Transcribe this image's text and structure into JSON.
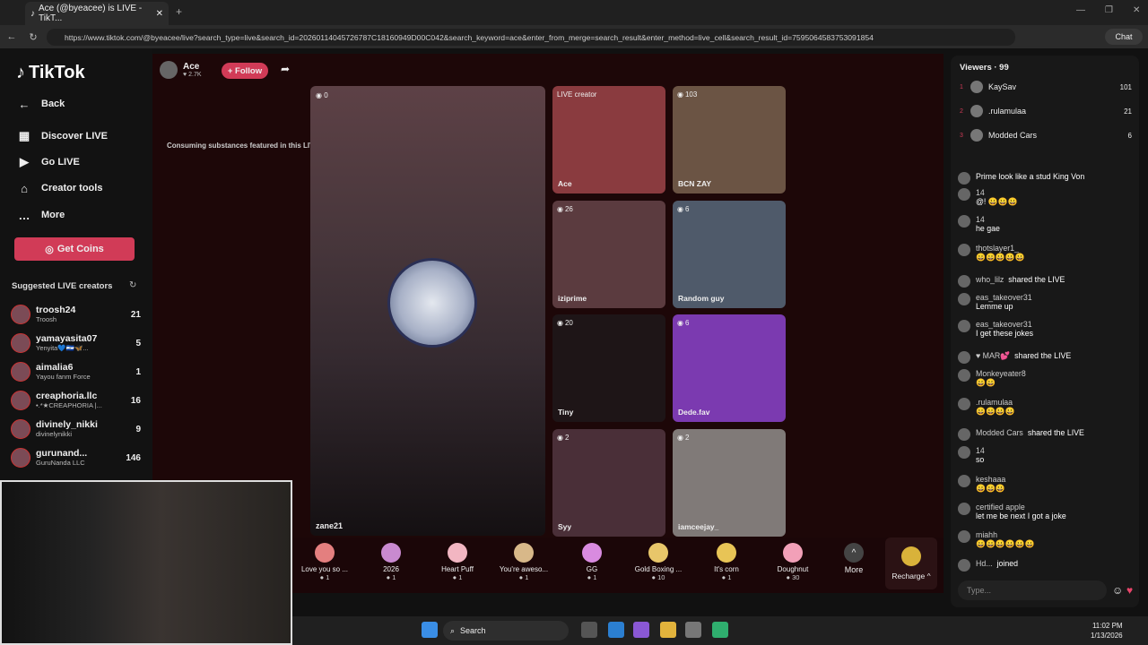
{
  "browser": {
    "tab_title": "Ace (@byeacee) is LIVE - TikT...",
    "url": "https://www.tiktok.com/@byeacee/live?search_type=live&search_id=20260114045726787C18160949D00C042&search_keyword=ace&enter_from_merge=search_result&enter_method=live_cell&search_result_id=7595064583753091854",
    "chat_label": "Chat"
  },
  "sidebar": {
    "logo": "TikTok",
    "nav": [
      {
        "label": "Back",
        "icon": "back-icon"
      },
      {
        "label": "Discover LIVE",
        "icon": "calendar-icon"
      },
      {
        "label": "Go LIVE",
        "icon": "camera-icon"
      },
      {
        "label": "Creator tools",
        "icon": "lightbulb-icon"
      },
      {
        "label": "More",
        "icon": "dots-icon"
      }
    ],
    "coins": "Get Coins",
    "suggested_title": "Suggested LIVE creators",
    "creators": [
      {
        "name": "troosh24",
        "sub": "Troosh",
        "count": "21"
      },
      {
        "name": "yamayasita07",
        "sub": "Yenyita💙🇸🇻🦋...",
        "count": "5"
      },
      {
        "name": "aimalia6",
        "sub": "Yayou fanm Force",
        "count": "1"
      },
      {
        "name": "creaphoria.llc",
        "sub": "•.*★CREAPHORIA |...",
        "count": "16"
      },
      {
        "name": "divinely_nikki",
        "sub": "divinelynikki",
        "count": "9"
      },
      {
        "name": "gurunand...",
        "sub": "GuruNanda LLC",
        "count": "146"
      }
    ]
  },
  "stage": {
    "host_name": "Ace",
    "host_likes": "♥ 2.7K",
    "follow": "+ Follow",
    "warning": "Consuming substances featured in this LIVE could ha...",
    "main": {
      "viewers": "0",
      "name": "zane21"
    },
    "tiles": [
      {
        "name": "Ace",
        "viewers": "LIVE creator",
        "bg": "#8a3b3f"
      },
      {
        "name": "BCN ZAY",
        "viewers": "103",
        "bg": "#6b5444"
      },
      {
        "name": "iziprime",
        "viewers": "26",
        "bg": "#5b3b3f"
      },
      {
        "name": "Random guy",
        "viewers": "6",
        "bg": "#4f5a6a"
      },
      {
        "name": "Tiny",
        "viewers": "20",
        "bg": "#1e1517"
      },
      {
        "name": "Dede.fav",
        "viewers": "6",
        "bg": "#7b3ab0"
      },
      {
        "name": "Syy",
        "viewers": "2",
        "bg": "#4a2f38"
      },
      {
        "name": "iamceejay_",
        "viewers": "2",
        "bg": "#807a78"
      }
    ]
  },
  "gifts": [
    {
      "name": "Love you so ...",
      "cost": "1",
      "color": "#e47f7f"
    },
    {
      "name": "2026",
      "cost": "1",
      "color": "#c98ad0"
    },
    {
      "name": "Heart Puff",
      "cost": "1",
      "color": "#f2b6c2"
    },
    {
      "name": "You're aweso...",
      "cost": "1",
      "color": "#d8b889"
    },
    {
      "name": "GG",
      "cost": "1",
      "color": "#d98be0"
    },
    {
      "name": "Gold Boxing ...",
      "cost": "10",
      "color": "#e8c66a"
    },
    {
      "name": "It's corn",
      "cost": "1",
      "color": "#e8c456"
    },
    {
      "name": "Doughnut",
      "cost": "30",
      "color": "#f2a0b8"
    }
  ],
  "gifts_more": "More",
  "recharge": "Recharge ^",
  "chat": {
    "viewers_title": "Viewers · 99",
    "viewers": [
      {
        "rank": "1",
        "name": "KaySav",
        "count": "101"
      },
      {
        "rank": "2",
        "name": ".rulamulaa",
        "count": "21"
      },
      {
        "rank": "3",
        "name": "Modded Cars",
        "count": "6"
      }
    ],
    "messages": [
      {
        "user": "",
        "text": "Prime look like a stud King Von"
      },
      {
        "user": "14",
        "text": "@! 😀😀😀"
      },
      {
        "user": "14",
        "text": "he gae"
      },
      {
        "user": "thotslayer1_",
        "text": "😀😀😀😀😀"
      },
      {
        "user": "who_lilz",
        "text": "shared the LIVE"
      },
      {
        "user": "eas_takeover31",
        "text": "Lemme up"
      },
      {
        "user": "eas_takeover31",
        "text": "I get these jokes"
      },
      {
        "user": "♥ MAR💕",
        "text": "shared the LIVE"
      },
      {
        "user": "Monkeyeater8",
        "text": "😀😀"
      },
      {
        "user": ".rulamulaa",
        "text": "😀😀😀😀"
      },
      {
        "user": "Modded Cars",
        "text": "shared the LIVE"
      },
      {
        "user": "14",
        "text": "so"
      },
      {
        "user": "keshaaa",
        "text": "😀😀😀"
      },
      {
        "user": "certified apple",
        "text": "let me be next I got a joke"
      },
      {
        "user": "miahh",
        "text": "😀😀😀😀😀😀"
      },
      {
        "user": "Hd...",
        "text": "joined"
      }
    ],
    "placeholder": "Type..."
  },
  "taskbar": {
    "search": "Search",
    "time": "11:02 PM",
    "date": "1/13/2026"
  }
}
